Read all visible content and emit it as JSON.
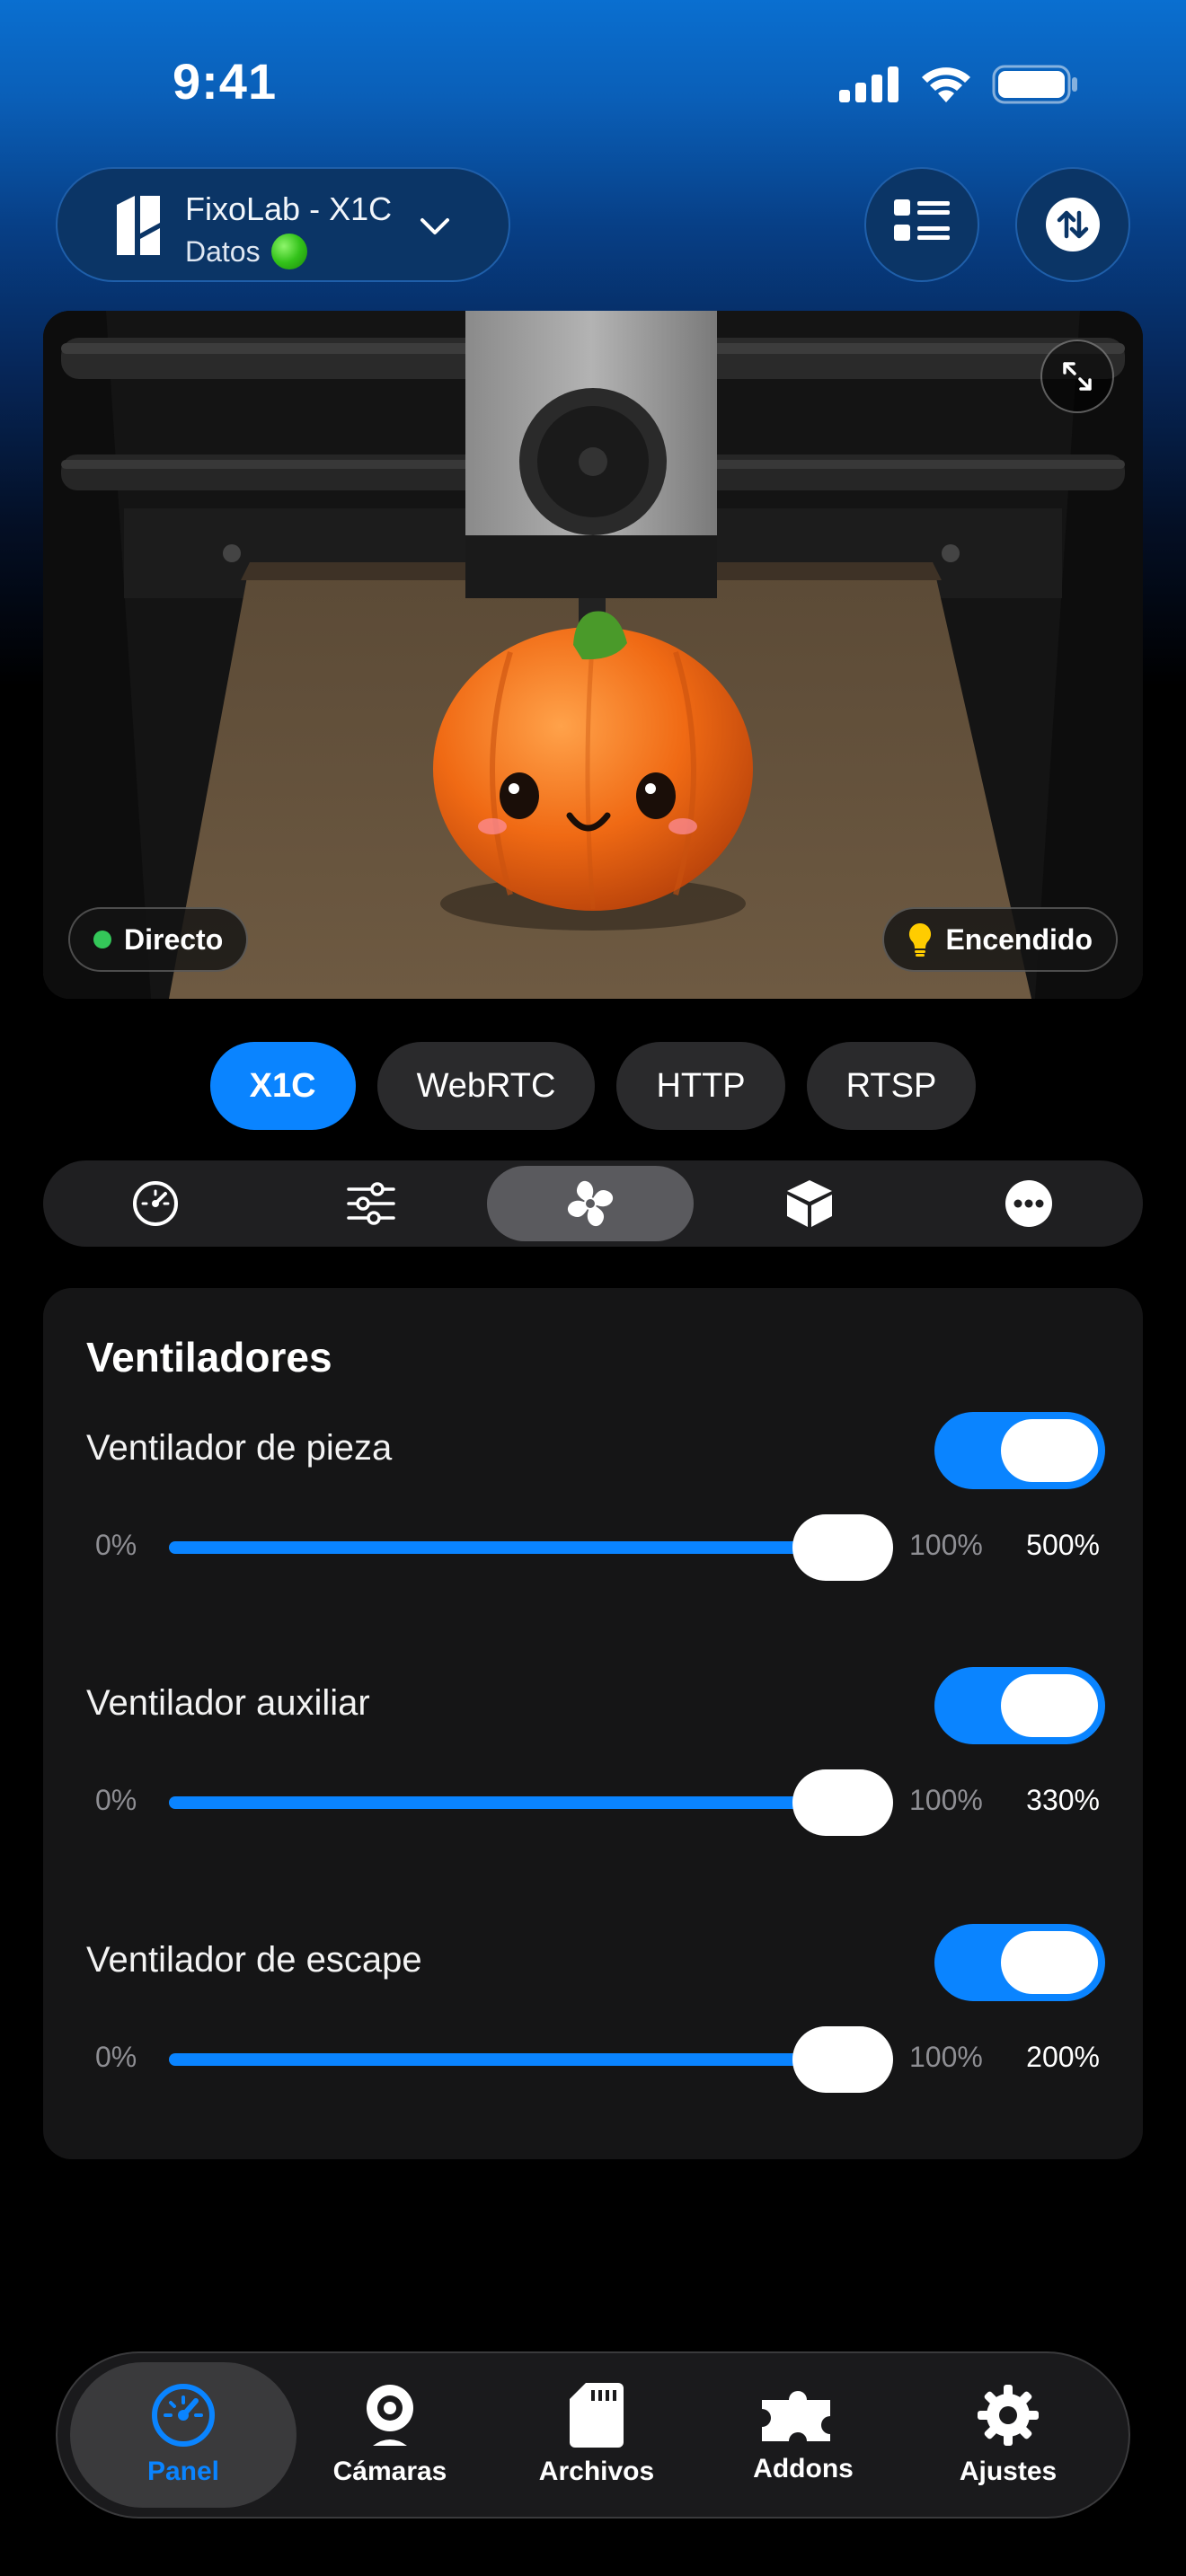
{
  "status_bar": {
    "time": "9:41"
  },
  "header": {
    "printer_name": "FixoLab - X1C",
    "printer_sub": "Datos",
    "icons": [
      "printer-logo-icon",
      "chevron-down-icon",
      "list-icon",
      "swap-arrows-icon"
    ]
  },
  "camera": {
    "live_label": "Directo",
    "light_label": "Encendido",
    "icons": [
      "expand-icon",
      "lightbulb-icon"
    ]
  },
  "stream_tabs": [
    {
      "label": "X1C",
      "active": true
    },
    {
      "label": "WebRTC",
      "active": false
    },
    {
      "label": "HTTP",
      "active": false
    },
    {
      "label": "RTSP",
      "active": false
    }
  ],
  "sections": [
    {
      "icon": "speedometer-icon",
      "active": false
    },
    {
      "icon": "sliders-icon",
      "active": false
    },
    {
      "icon": "fan-icon",
      "active": true
    },
    {
      "icon": "box-icon",
      "active": false
    },
    {
      "icon": "more-icon",
      "active": false
    }
  ],
  "fans_card": {
    "title": "Ventiladores",
    "fans": [
      {
        "label": "Ventilador de pieza",
        "enabled": true,
        "min": "0%",
        "max": "100%",
        "value_label": "500%",
        "level": 1.0
      },
      {
        "label": "Ventilador auxiliar",
        "enabled": true,
        "min": "0%",
        "max": "100%",
        "value_label": "330%",
        "level": 1.0
      },
      {
        "label": "Ventilador de escape",
        "enabled": true,
        "min": "0%",
        "max": "100%",
        "value_label": "200%",
        "level": 1.0
      }
    ]
  },
  "tabbar": [
    {
      "label": "Panel",
      "icon": "dashboard-gauge-icon",
      "active": true
    },
    {
      "label": "Cámaras",
      "icon": "webcam-icon",
      "active": false
    },
    {
      "label": "Archivos",
      "icon": "sd-card-icon",
      "active": false
    },
    {
      "label": "Addons",
      "icon": "puzzle-icon",
      "active": false
    },
    {
      "label": "Ajustes",
      "icon": "gear-icon",
      "active": false
    }
  ],
  "colors": {
    "accent": "#0a84ff",
    "live": "#34c759",
    "card": "#151516"
  }
}
